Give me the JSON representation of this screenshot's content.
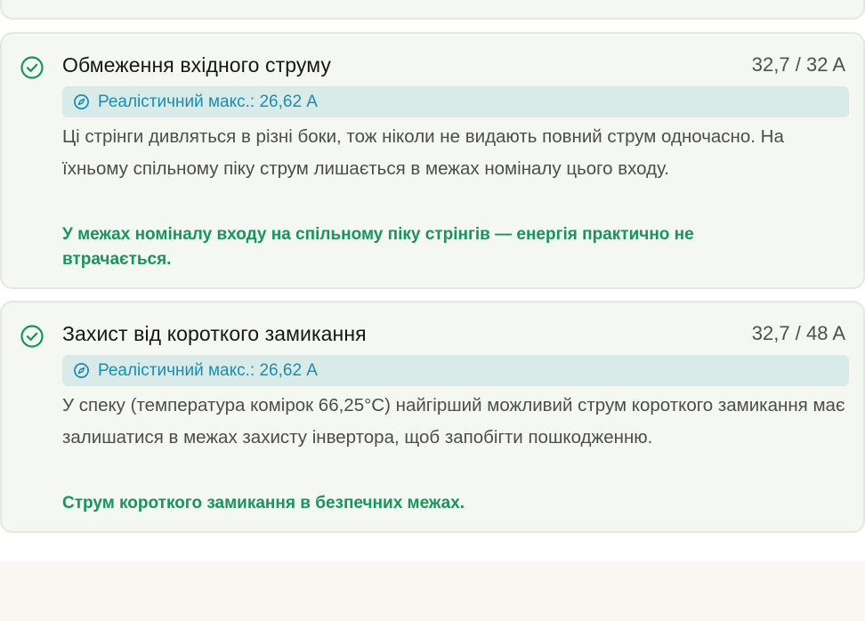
{
  "checks": [
    {
      "title": "Обмеження вхідного струму",
      "value": "32,7 / 32 A",
      "realistic": "Реалістичний макс.: 26,62 A",
      "description": "Ці стрінги дивляться в різні боки, тож ніколи не видають повний струм одночасно. На їхньому спільному піку струм лишається в межах номіналу цього входу.",
      "note": "У межах номіналу входу на спільному піку стрінгів — енергія практично не втрачається.",
      "status_icon": "check-circle-icon",
      "realistic_icon": "compass-icon"
    },
    {
      "title": "Захист від короткого замикання",
      "value": "32,7 / 48 A",
      "realistic": "Реалістичний макс.: 26,62 A",
      "description": "У спеку (температура комірок 66,25°C) найгірший можливий струм короткого замикання має залишатися в межах захисту інвертора, щоб запобігти пошкодженню.",
      "note": "Струм короткого замикання в безпечних межах.",
      "status_icon": "check-circle-icon",
      "realistic_icon": "compass-icon"
    }
  ],
  "colors": {
    "success": "#17955b",
    "info": "#1d8bb0",
    "info_bg": "#d9ebe9",
    "card_bg": "#f4f7f2"
  }
}
